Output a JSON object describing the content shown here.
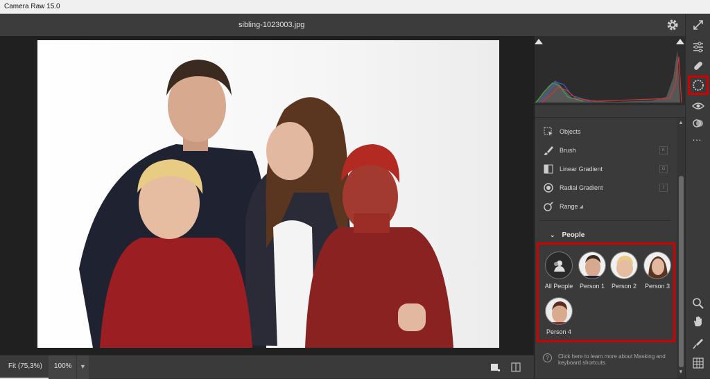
{
  "app": {
    "title": "Camera Raw 15.0"
  },
  "header": {
    "filename": "sibling-1023003.jpg",
    "settings_icon": "gear-icon",
    "fullscreen_icon": "expand-icon"
  },
  "mask_tools": [
    {
      "label": "Objects",
      "icon": "objects-icon",
      "shortcut": ""
    },
    {
      "label": "Brush",
      "icon": "brush-icon",
      "shortcut": "K"
    },
    {
      "label": "Linear Gradient",
      "icon": "linear-gradient-icon",
      "shortcut": "G"
    },
    {
      "label": "Radial Gradient",
      "icon": "radial-gradient-icon",
      "shortcut": "J"
    },
    {
      "label": "Range",
      "icon": "range-icon",
      "shortcut": ""
    }
  ],
  "people": {
    "heading": "People",
    "items": [
      {
        "label": "All People"
      },
      {
        "label": "Person 1"
      },
      {
        "label": "Person 2"
      },
      {
        "label": "Person 3"
      },
      {
        "label": "Person 4"
      }
    ]
  },
  "help": {
    "text": "Click here to learn more about Masking and keyboard shortcuts."
  },
  "footer": {
    "fit_label": "Fit (75,3%)",
    "zoom_label": "100%"
  },
  "colors": {
    "highlight": "#d40000",
    "panel": "#3a3a3a",
    "mask_overlay": "#9b1a1a"
  }
}
